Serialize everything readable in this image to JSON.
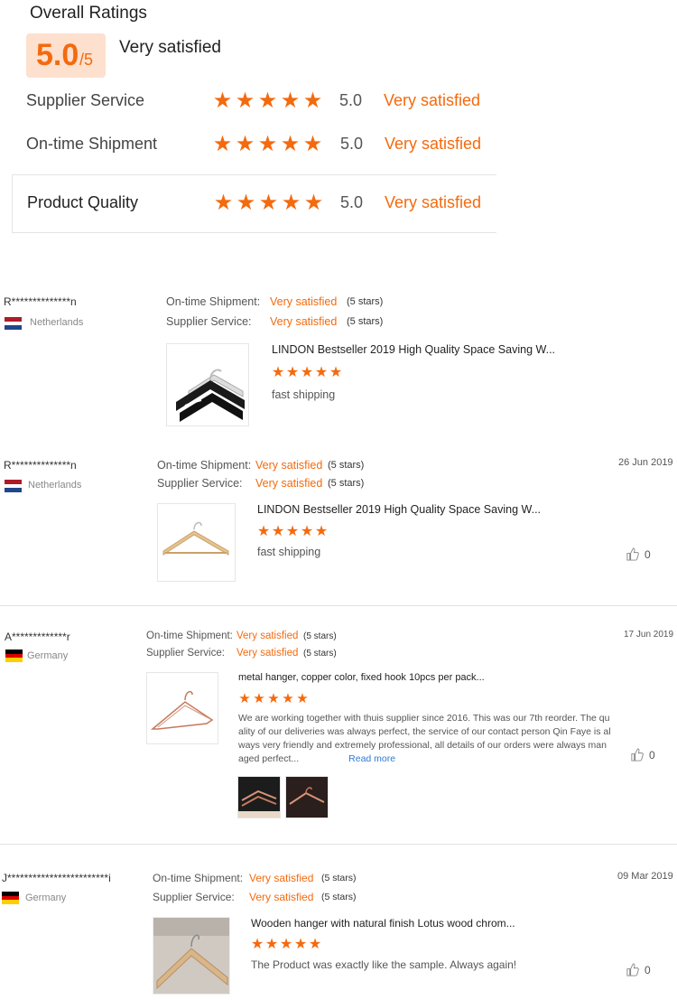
{
  "overall": {
    "title": "Overall Ratings",
    "score": "5.0",
    "score_den": "/5",
    "verdict": "Very satisfied",
    "ratings": [
      {
        "label": "Supplier Service",
        "value": "5.0",
        "verdict": "Very satisfied",
        "stars": 5
      },
      {
        "label": "On-time Shipment",
        "value": "5.0",
        "verdict": "Very satisfied",
        "stars": 5
      },
      {
        "label": "Product Quality",
        "value": "5.0",
        "verdict": "Very satisfied",
        "stars": 5
      }
    ]
  },
  "colors": {
    "accent": "#f46a0e",
    "score_bg": "#fde0ce",
    "link": "#2e7bd4"
  },
  "reviews": [
    {
      "name": "R**************n",
      "country": "Netherlands",
      "flag": "netherlands-flag",
      "shipment_label": "On-time Shipment:",
      "shipment_val": "Very satisfied",
      "shipment_stars": "(5 stars)",
      "service_label": "Supplier Service:",
      "service_val": "Very satisfied",
      "service_stars": "(5 stars)",
      "date": "",
      "product": "LINDON Bestseller 2019 High Quality Space Saving W...",
      "stars": 5,
      "comment": "fast shipping"
    },
    {
      "name": "R**************n",
      "country": "Netherlands",
      "flag": "netherlands-flag",
      "shipment_label": "On-time Shipment:",
      "shipment_val": "Very satisfied",
      "shipment_stars": "(5 stars)",
      "service_label": "Supplier Service:",
      "service_val": "Very satisfied",
      "service_stars": "(5 stars)",
      "date": "26 Jun 2019",
      "product": "LINDON Bestseller 2019 High Quality Space Saving W...",
      "stars": 5,
      "comment": "fast shipping",
      "likes": "0"
    },
    {
      "name": "A*************r",
      "country": "Germany",
      "flag": "germany-flag",
      "shipment_label": "On-time Shipment:",
      "shipment_val": "Very satisfied",
      "shipment_stars": "(5 stars)",
      "service_label": "Supplier Service:",
      "service_val": "Very satisfied",
      "service_stars": "(5 stars)",
      "date": "17 Jun 2019",
      "product": "metal hanger, copper color, fixed hook 10pcs per pack...",
      "stars": 5,
      "comment_lines": [
        "We are working together with thuis supplier since 2016. This was our 7th reorder. The qu",
        "ality of our deliveries was always perfect, the service of our contact person Qin Faye is al",
        "ways very friendly and extremely professional, all details of our orders were always man",
        "aged perfect..."
      ],
      "read_more": "Read more",
      "likes": "0"
    },
    {
      "name": "J************************i",
      "country": "Germany",
      "flag": "germany-flag",
      "shipment_label": "On-time Shipment:",
      "shipment_val": "Very satisfied",
      "shipment_stars": "(5 stars)",
      "service_label": "Supplier Service:",
      "service_val": "Very satisfied",
      "service_stars": "(5 stars)",
      "date": "09 Mar 2019",
      "product": "Wooden hanger with natural finish Lotus wood chrom...",
      "stars": 5,
      "comment": "The Product was exactly like the sample. Always again!",
      "likes": "0"
    }
  ]
}
